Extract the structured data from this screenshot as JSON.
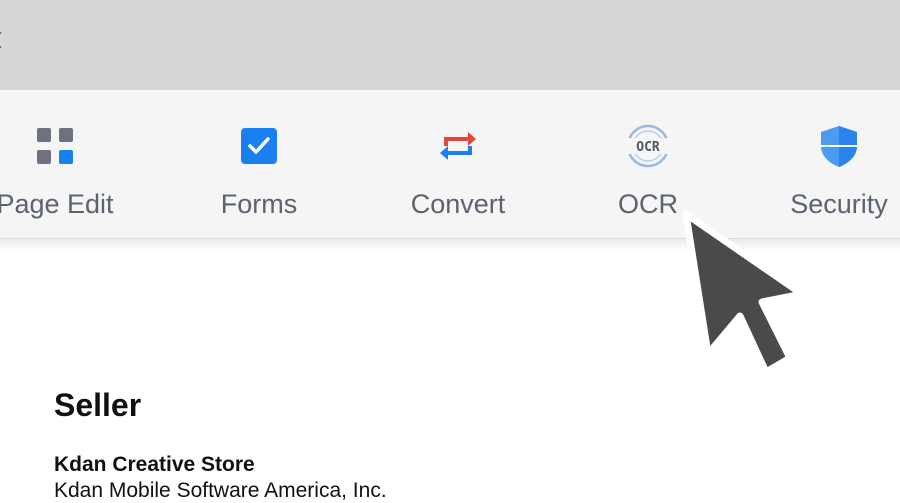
{
  "toolbar": {
    "items": [
      {
        "label": "Page Edit",
        "icon": "grid-icon"
      },
      {
        "label": "Forms",
        "icon": "checkbox-icon"
      },
      {
        "label": "Convert",
        "icon": "swap-arrows-icon"
      },
      {
        "label": "OCR",
        "icon": "ocr-icon",
        "icon_text": "OCR"
      },
      {
        "label": "Security",
        "icon": "shield-icon"
      }
    ]
  },
  "document": {
    "section_title": "Seller",
    "company_name": "Kdan Creative Store",
    "company_legal": "Kdan Mobile Software America, Inc."
  },
  "colors": {
    "accent_blue": "#1a7ff0",
    "convert_red": "#e8433b",
    "label_gray": "#5b6270",
    "cursor": "#4a4a4a"
  }
}
